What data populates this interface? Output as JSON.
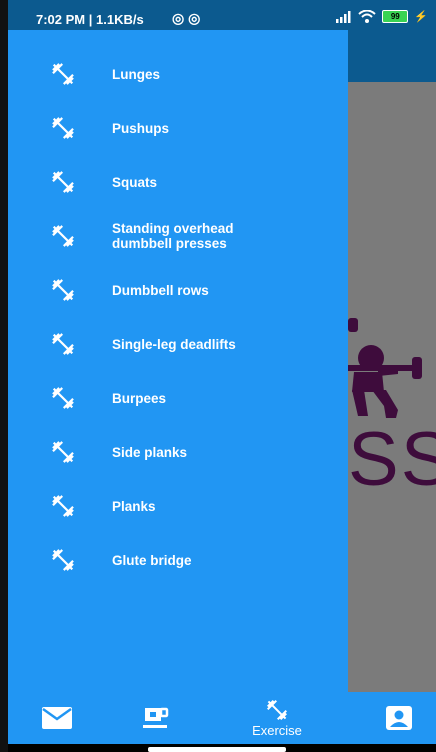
{
  "status_bar": {
    "time_speed": "7:02 PM | 1.1KB/s",
    "battery": "99"
  },
  "drawer": {
    "items": [
      {
        "label": "Lunges",
        "icon": "dumbbell-icon"
      },
      {
        "label": "Pushups",
        "icon": "dumbbell-icon"
      },
      {
        "label": "Squats",
        "icon": "dumbbell-icon"
      },
      {
        "label": "Standing overhead\ndumbbell presses",
        "icon": "dumbbell-icon"
      },
      {
        "label": "Dumbbell rows",
        "icon": "dumbbell-icon"
      },
      {
        "label": "Single-leg deadlifts",
        "icon": "dumbbell-icon"
      },
      {
        "label": "Burpees",
        "icon": "dumbbell-icon"
      },
      {
        "label": "Side planks",
        "icon": "dumbbell-icon"
      },
      {
        "label": "Planks",
        "icon": "dumbbell-icon"
      },
      {
        "label": "Glute bridge",
        "icon": "dumbbell-icon"
      }
    ]
  },
  "background": {
    "logo_text": "SS"
  },
  "bottom_nav": {
    "items": [
      {
        "label": "",
        "icon": "mail-icon"
      },
      {
        "label": "",
        "icon": "coffee-cup-icon"
      },
      {
        "label": "Exercise",
        "icon": "dumbbell-icon",
        "active": true
      },
      {
        "label": "",
        "icon": "profile-icon"
      }
    ]
  },
  "colors": {
    "drawer": "#2196f3",
    "app_bar": "#0c5a8f",
    "logo": "#3e0c3c"
  }
}
